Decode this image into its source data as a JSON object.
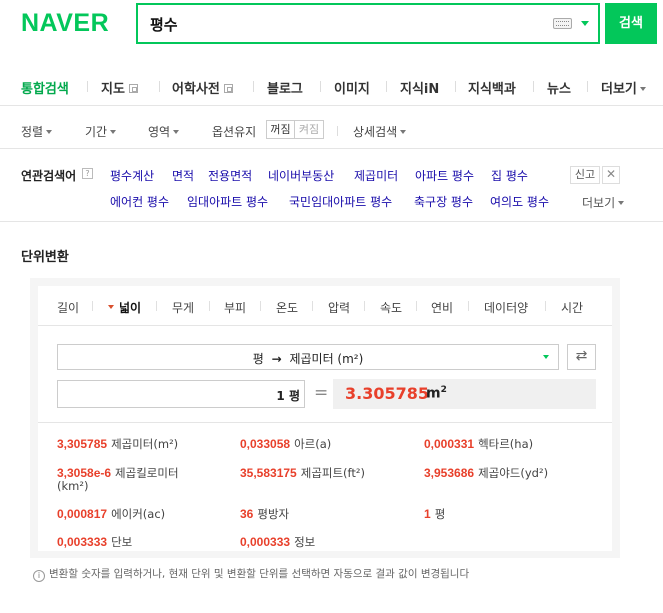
{
  "header": {
    "logo": "NAVER",
    "query": "평수",
    "search_button": "검색"
  },
  "nav": {
    "items": [
      {
        "label": "통합검색",
        "active": true
      },
      {
        "label": "지도"
      },
      {
        "label": "어학사전"
      },
      {
        "label": "블로그"
      },
      {
        "label": "이미지"
      },
      {
        "label": "지식iN"
      },
      {
        "label": "지식백과"
      },
      {
        "label": "뉴스"
      },
      {
        "label": "더보기"
      }
    ]
  },
  "options": {
    "sort": "정렬",
    "period": "기간",
    "area": "영역",
    "keep_options": "옵션유지",
    "toggle_on": "꺼짐",
    "toggle_off": "켜짐",
    "detail_search": "상세검색"
  },
  "related": {
    "title": "연관검색어",
    "help": "?",
    "report": "신고",
    "more": "더보기",
    "row1": [
      "평수계산",
      "면적",
      "전용면적",
      "네이버부동산",
      "제곱미터",
      "아파트 평수",
      "집 평수"
    ],
    "row2": [
      "에어컨 평수",
      "임대아파트 평수",
      "국민임대아파트 평수",
      "축구장 평수",
      "여의도 평수"
    ]
  },
  "converter": {
    "title": "단위변환",
    "tabs": [
      "길이",
      "넓이",
      "무게",
      "부피",
      "온도",
      "압력",
      "속도",
      "연비",
      "데이터양",
      "시간"
    ],
    "active_tab": "넓이",
    "select_from": "평",
    "select_arrow": "→",
    "select_to": "제곱미터 (m²)",
    "input_value": "1 평",
    "equals": "=",
    "result_value": "3.305785",
    "result_unit": "m",
    "result_unit_sup": "2",
    "results": [
      {
        "value": "3,305785",
        "unit": "제곱미터(m²)"
      },
      {
        "value": "0,033058",
        "unit": "아르(a)"
      },
      {
        "value": "0,000331",
        "unit": "헥타르(ha)"
      },
      {
        "value": "3,3058e-6",
        "unit": "제곱킬로미터",
        "unit2": "(km²)"
      },
      {
        "value": "35,583175",
        "unit": "제곱피트(ft²)"
      },
      {
        "value": "3,953686",
        "unit": "제곱야드(yd²)"
      },
      {
        "value": "0,000817",
        "unit": "에이커(ac)"
      },
      {
        "value": "36",
        "unit": "평방자"
      },
      {
        "value": "1",
        "unit": "평"
      },
      {
        "value": "0,003333",
        "unit": "단보"
      },
      {
        "value": "0,000333",
        "unit": "정보"
      }
    ],
    "note": "변환할 숫자를 입력하거나, 현재 단위 및 변환할 단위를 선택하면 자동으로 결과 값이 변경됩니다"
  }
}
